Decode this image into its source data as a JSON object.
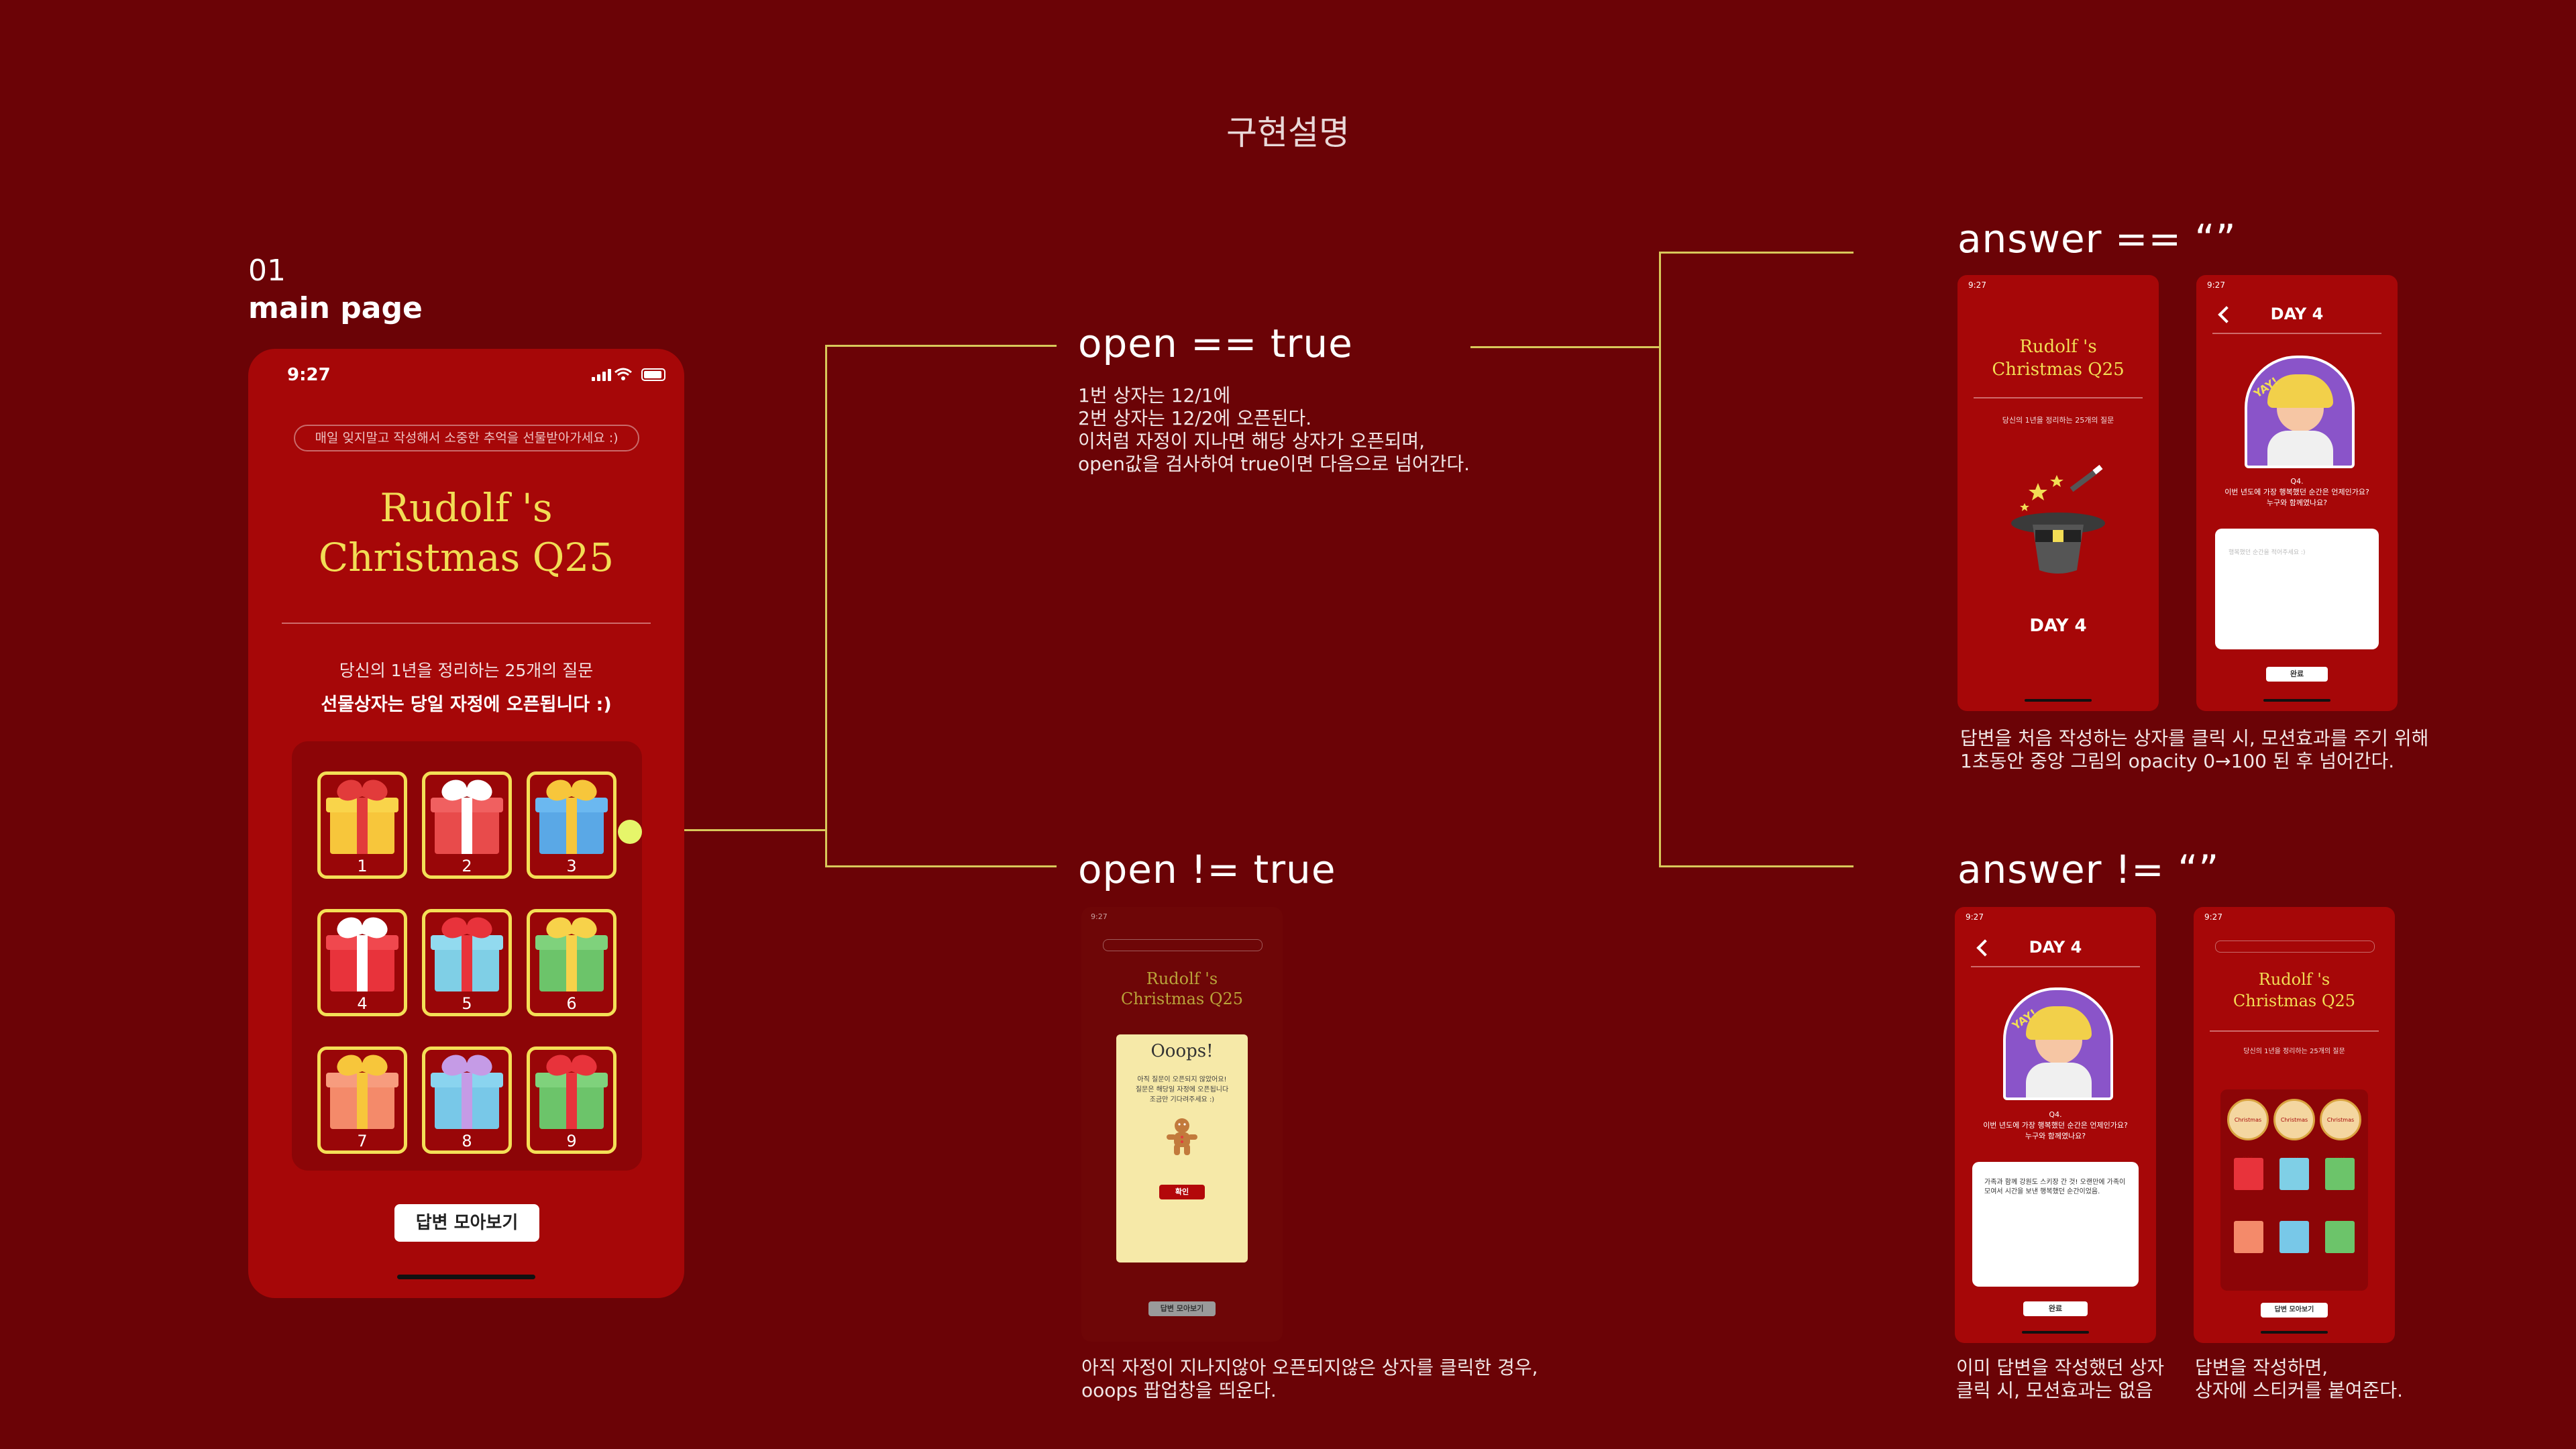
{
  "header": {
    "title": "구현설명"
  },
  "step": {
    "number": "01",
    "name": "main page"
  },
  "conditions": {
    "open_true": "open == true",
    "open_false": "open != true",
    "answer_empty": "answer == “”",
    "answer_filled": "answer != “”"
  },
  "descriptions": {
    "open_true": [
      "1번 상자는 12/1에",
      "2번 상자는 12/2에 오픈된다.",
      "이처럼 자정이 지나면 해당 상자가 오픈되며,",
      "open값을 검사하여 true이면 다음으로 넘어간다."
    ],
    "open_false": [
      "아직 자정이 지나지않아 오픈되지않은 상자를 클릭한 경우,",
      "ooops 팝업창을 띄운다."
    ],
    "answer_empty": [
      "답변을 처음 작성하는 상자를 클릭 시, 모션효과를 주기 위해",
      "1초동안 중앙 그림의 opacity 0→100 된 후 넘어간다."
    ],
    "answer_filled_a": [
      "이미 답변을 작성했던 상자",
      "클릭 시, 모션효과는 없음"
    ],
    "answer_filled_b": [
      "답변을 작성하면,",
      "상자에 스티커를 붙여준다."
    ]
  },
  "main_phone": {
    "time": "9:27",
    "notice": "매일 잊지말고 작성해서 소중한 추억을 선물받아가세요 :)",
    "title_line1": "Rudolf 's",
    "title_line2": "Christmas Q25",
    "subtitle": "당신의 1년을 정리하는 25개의 질문",
    "subtitle_bold": "선물상자는 당일 자정에 오픈됩니다 :)",
    "gifts": [
      {
        "num": "1",
        "box": "#f7c63b",
        "lid": "#f9d44a",
        "ribbon": "#e23b3b"
      },
      {
        "num": "2",
        "box": "#e84b4b",
        "lid": "#f06060",
        "ribbon": "#ffffff"
      },
      {
        "num": "3",
        "box": "#5aa8e6",
        "lid": "#6bb8f0",
        "ribbon": "#f7c63b"
      },
      {
        "num": "4",
        "box": "#e8333b",
        "lid": "#f0484e",
        "ribbon": "#ffffff"
      },
      {
        "num": "5",
        "box": "#7fcfe6",
        "lid": "#92daef",
        "ribbon": "#e8333b"
      },
      {
        "num": "6",
        "box": "#6cc46a",
        "lid": "#7fd27c",
        "ribbon": "#f7d24a"
      },
      {
        "num": "7",
        "box": "#f48a6a",
        "lid": "#f79c7e",
        "ribbon": "#f7c63b"
      },
      {
        "num": "8",
        "box": "#78c8e8",
        "lid": "#8ad4ef",
        "ribbon": "#c59be6"
      },
      {
        "num": "9",
        "box": "#6cc46a",
        "lid": "#7fd27c",
        "ribbon": "#e8333b"
      }
    ],
    "collect_button": "답변 모아보기"
  },
  "screens": {
    "time": "9:27",
    "title_line1": "Rudolf 's",
    "title_line2": "Christmas Q25",
    "subtitle": "당신의 1년을 정리하는 25개의 질문",
    "day_label": "DAY 4",
    "sticker_text": "YAY!",
    "question_no": "Q4.",
    "question_line1": "이번 년도에 가장 행복했던 순간은 언제인가요?",
    "question_line2": "누구와 함께였나요?",
    "answer_placeholder": "행복했던 순간을 적어주세요 :)",
    "answer_text": "가족과 함께 강원도 스키장 간 것! 오랜만에 가족이 모여서 시간을 보낸 행복했던 순간이었음.",
    "done_button": "완료",
    "popup_title": "Ooops!",
    "popup_line1": "아직 질문이 오픈되지 않았어요!",
    "popup_line2": "질문은 해당일 자정에 오픈됩니다",
    "popup_line3": "조금만 기다려주세요 :)",
    "popup_button": "확인",
    "sticker_label": "Christmas Q25",
    "collect_button": "답변 모아보기"
  }
}
